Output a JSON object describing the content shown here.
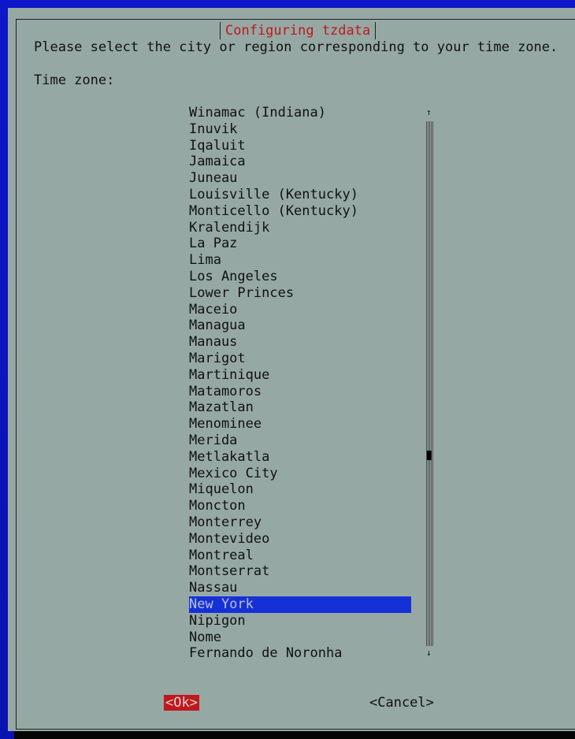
{
  "dialog": {
    "title": "Configuring tzdata",
    "prompt": "Please select the city or region corresponding to your time zone.",
    "field_label": "Time zone:"
  },
  "timezones": {
    "items": [
      "Winamac (Indiana)",
      "Inuvik",
      "Iqaluit",
      "Jamaica",
      "Juneau",
      "Louisville (Kentucky)",
      "Monticello (Kentucky)",
      "Kralendijk",
      "La Paz",
      "Lima",
      "Los Angeles",
      "Lower Princes",
      "Maceio",
      "Managua",
      "Manaus",
      "Marigot",
      "Martinique",
      "Matamoros",
      "Mazatlan",
      "Menominee",
      "Merida",
      "Metlakatla",
      "Mexico City",
      "Miquelon",
      "Moncton",
      "Monterrey",
      "Montevideo",
      "Montreal",
      "Montserrat",
      "Nassau",
      "New York",
      "Nipigon",
      "Nome",
      "Fernando de Noronha"
    ],
    "selected": "New York"
  },
  "scrollbar": {
    "up_arrow": "↑",
    "down_arrow": "↓"
  },
  "buttons": {
    "ok": "<Ok>",
    "cancel": "<Cancel>"
  },
  "colors": {
    "dialog_bg": "#96a8a4",
    "title_text": "#c0181c",
    "selection_bg": "#1630d8",
    "screen_bg": "#0d16c8"
  }
}
